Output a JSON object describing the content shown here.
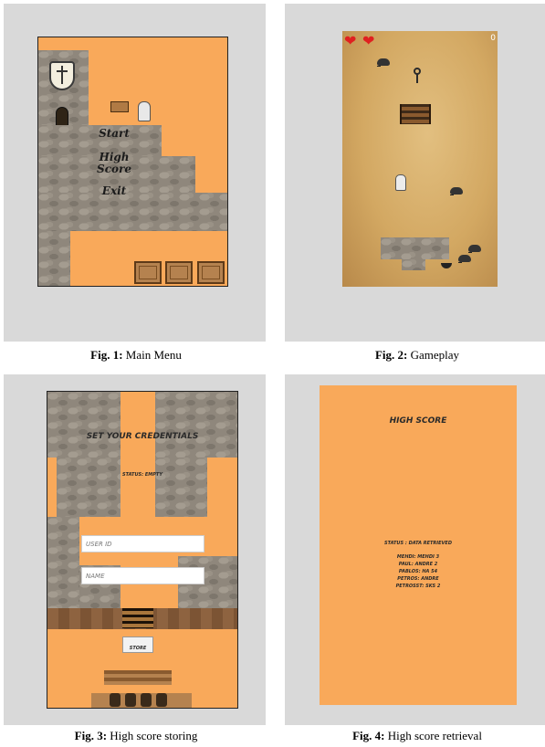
{
  "figures": [
    {
      "num": "Fig. 1:",
      "caption": "Main Menu"
    },
    {
      "num": "Fig. 2:",
      "caption": "Gameplay"
    },
    {
      "num": "Fig. 3:",
      "caption": "High score storing"
    },
    {
      "num": "Fig. 4:",
      "caption": "High score retrieval"
    }
  ],
  "main_menu": {
    "items": [
      "Start",
      "High Score",
      "Exit"
    ]
  },
  "gameplay": {
    "score": "0",
    "lives": 2
  },
  "credentials": {
    "title": "SET YOUR CREDENTIALS",
    "status": "STATUS: EMPTY",
    "user_id_placeholder": "USER ID",
    "name_placeholder": "NAME",
    "store_label": "STORE"
  },
  "highscore": {
    "title": "HIGH SCORE",
    "status": "STATUS : DATA RETRIEVED",
    "entries": [
      "MEHDI: MEHDI 3",
      "PAUL: ANDRE 2",
      "PABLOS: HA 54",
      "PETROS: ANDRE",
      "PETROSST: SKS 2"
    ]
  },
  "colors": {
    "orange": "#f9a95a",
    "panel": "#d9d9d9",
    "heart": "#e02020"
  }
}
